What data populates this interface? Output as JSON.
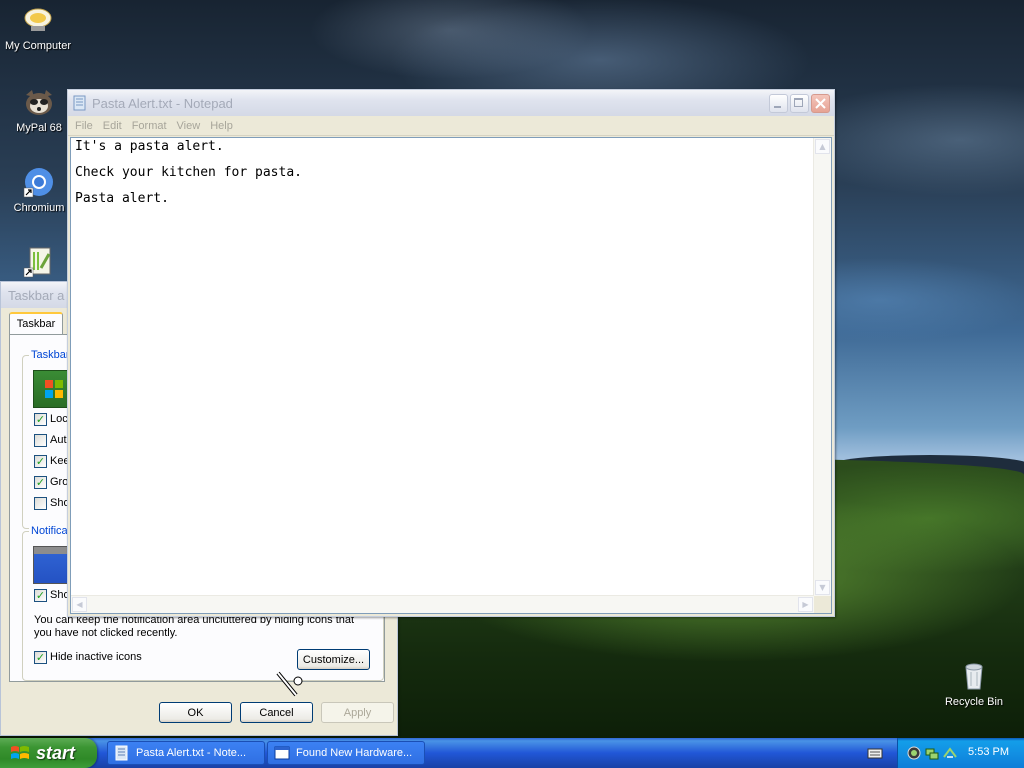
{
  "desktop": {
    "icons": [
      {
        "label": "My Computer",
        "icon": "my-computer-icon"
      },
      {
        "label": "MyPal 68",
        "icon": "mypal-browser-icon"
      },
      {
        "label": "Chromium",
        "icon": "chromium-icon"
      },
      {
        "label": "",
        "icon": "notepadpp-shortcut-icon"
      },
      {
        "label": "Recycle Bin",
        "icon": "recycle-bin-icon"
      }
    ]
  },
  "notepad": {
    "title": "Pasta Alert.txt - Notepad",
    "menu": [
      "File",
      "Edit",
      "Format",
      "View",
      "Help"
    ],
    "lines": [
      "It's a pasta alert.",
      "Check your kitchen for pasta.",
      "Pasta alert."
    ]
  },
  "taskbar_dialog": {
    "title": "Taskbar a",
    "tab": "Taskbar",
    "group1_label": "Taskbar",
    "checkboxes": [
      {
        "label": "Loc",
        "checked": true
      },
      {
        "label": "Auto",
        "checked": false
      },
      {
        "label": "Kee",
        "checked": true
      },
      {
        "label": "Gro",
        "checked": true
      },
      {
        "label": "Sho",
        "checked": false
      }
    ],
    "group2_label": "Notifica",
    "show_clock": {
      "label": "Sho",
      "checked": true
    },
    "description": "You can keep the notification area uncluttered by hiding icons that you have not clicked recently.",
    "hide_inactive": {
      "label": "Hide inactive icons",
      "checked": true
    },
    "customize_label": "Customize...",
    "ok_label": "OK",
    "cancel_label": "Cancel",
    "apply_label": "Apply"
  },
  "taskbar": {
    "start_label": "start",
    "buttons": [
      {
        "label": "Pasta Alert.txt - Note...",
        "icon": "notepad-icon"
      },
      {
        "label": "Found New Hardware...",
        "icon": "window-icon"
      }
    ],
    "clock": "5:53 PM"
  }
}
